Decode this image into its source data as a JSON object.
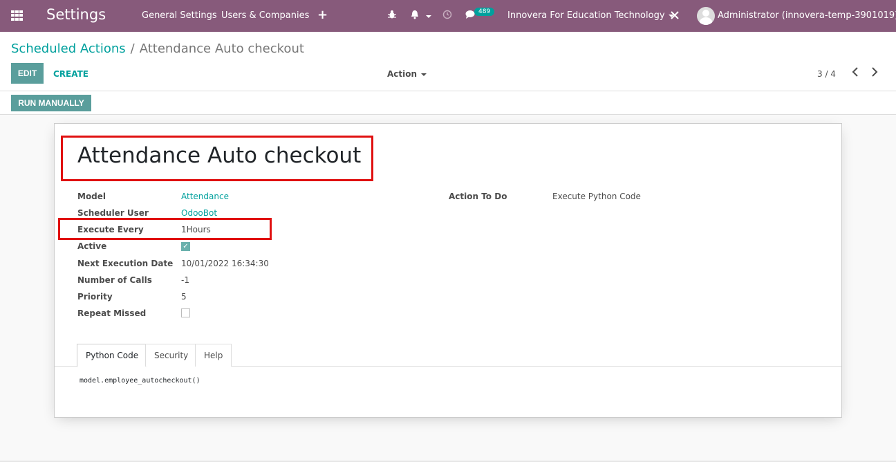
{
  "navbar": {
    "app_title": "Settings",
    "menu": [
      "General Settings",
      "Users & Companies"
    ],
    "new_label": "+",
    "messages_badge": "489",
    "company": "Innovera For Education Technology",
    "user": "Administrator (innovera-temp-3901019)"
  },
  "breadcrumb": {
    "parent": "Scheduled Actions",
    "separator": "/",
    "current": "Attendance Auto checkout"
  },
  "buttons": {
    "edit": "EDIT",
    "create": "CREATE",
    "action": "Action",
    "run_manually": "RUN MANUALLY"
  },
  "pager": {
    "text": "3 / 4",
    "prev": "‹",
    "next": "›"
  },
  "record": {
    "title": "Attendance Auto checkout",
    "fields": [
      {
        "label": "Model",
        "value": "Attendance"
      },
      {
        "label": "Scheduler User",
        "value": "OdooBot"
      },
      {
        "label": "Execute Every",
        "value": "1Hours"
      },
      {
        "label": "Active",
        "value": "✓"
      },
      {
        "label": "Next Execution Date",
        "value": "10/01/2022 16:34:30"
      },
      {
        "label": "Number of Calls",
        "value": "-1"
      },
      {
        "label": "Priority",
        "value": "5"
      },
      {
        "label": "Repeat Missed",
        "value": ""
      }
    ],
    "action_to_do_label": "Action To Do",
    "action_to_do_value": "Execute Python Code"
  },
  "tabs": [
    "Python Code",
    "Security",
    "Help"
  ],
  "code": "model.employee_autocheckout()",
  "icons": {
    "apps": "apps-grid-icon",
    "bug": "bug-icon",
    "bell": "bell-icon",
    "clock": "clock-icon",
    "chat": "chat-icon",
    "tools": "tools-icon",
    "avatar": "avatar-icon"
  },
  "colors": {
    "navbar": "#875a7b",
    "accent": "#00a09d",
    "highlight": "#e01010"
  }
}
